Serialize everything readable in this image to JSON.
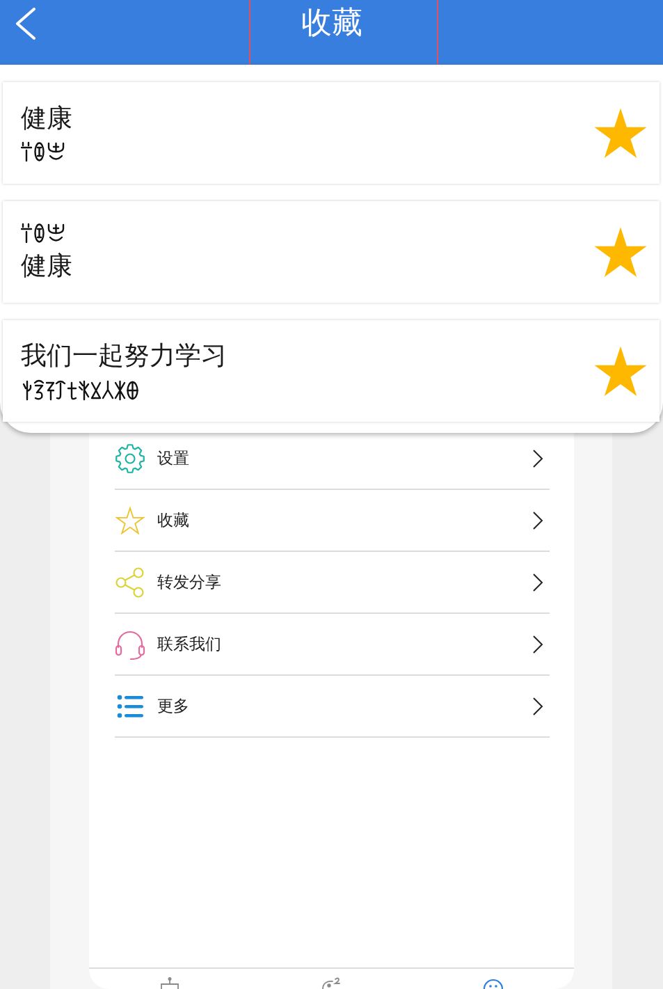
{
  "header": {
    "title": "收藏"
  },
  "favorites": [
    {
      "lines": [
        {
          "kind": "text",
          "text": "健康"
        },
        {
          "kind": "script"
        }
      ],
      "starred": true
    },
    {
      "lines": [
        {
          "kind": "script"
        },
        {
          "kind": "text",
          "text": "健康"
        }
      ],
      "starred": true
    },
    {
      "lines": [
        {
          "kind": "text",
          "text": "我们一起努力学习"
        },
        {
          "kind": "script"
        }
      ],
      "starred": true
    }
  ],
  "menu": [
    {
      "label": "设置"
    },
    {
      "label": "收藏"
    },
    {
      "label": "转发分享"
    },
    {
      "label": "联系我们"
    },
    {
      "label": "更多"
    }
  ],
  "tab_bar": {
    "tabs": [
      {
        "selected": false
      },
      {
        "selected": false
      },
      {
        "selected": true
      }
    ]
  }
}
